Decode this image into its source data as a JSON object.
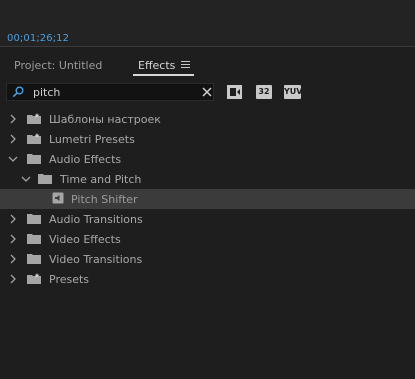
{
  "timeline": {
    "timecode": "00;01;26;12"
  },
  "panel": {
    "tabs": [
      {
        "label": "Project: Untitled",
        "active": false
      },
      {
        "label": "Effects",
        "active": true
      }
    ],
    "menu_icon": "hamburger-icon"
  },
  "search": {
    "value": "pitch",
    "placeholder": ""
  },
  "filters": [
    {
      "name": "accelerated-effects",
      "label": ""
    },
    {
      "name": "32-bit",
      "label": "32"
    },
    {
      "name": "yuv",
      "label": "YUV"
    }
  ],
  "tree": [
    {
      "label": "Шаблоны настроек",
      "level": 0,
      "expanded": false,
      "icon": "preset-folder-icon"
    },
    {
      "label": "Lumetri Presets",
      "level": 0,
      "expanded": false,
      "icon": "preset-folder-icon"
    },
    {
      "label": "Audio Effects",
      "level": 0,
      "expanded": true,
      "icon": "folder-icon"
    },
    {
      "label": "Time and Pitch",
      "level": 1,
      "expanded": true,
      "icon": "folder-icon"
    },
    {
      "label": "Pitch Shifter",
      "level": 2,
      "expanded": null,
      "icon": "audio-effect-icon",
      "selected": true
    },
    {
      "label": "Audio Transitions",
      "level": 0,
      "expanded": false,
      "icon": "folder-icon"
    },
    {
      "label": "Video Effects",
      "level": 0,
      "expanded": false,
      "icon": "folder-icon"
    },
    {
      "label": "Video Transitions",
      "level": 0,
      "expanded": false,
      "icon": "folder-icon"
    },
    {
      "label": "Presets",
      "level": 0,
      "expanded": false,
      "icon": "preset-folder-icon"
    }
  ],
  "colors": {
    "timecode": "#4a9fe0",
    "selection": "#3b3b3b",
    "background": "#1e1e1e"
  }
}
